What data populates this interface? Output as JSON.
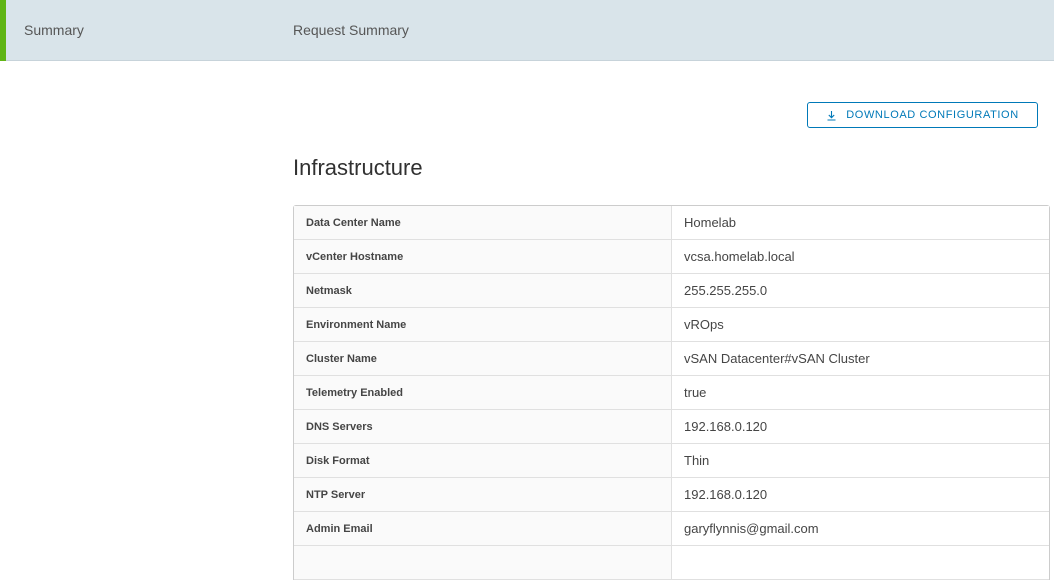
{
  "header": {
    "step_label": "Summary",
    "title": "Request Summary",
    "accent_color": "#60b515"
  },
  "actions": {
    "download_label": "DOWNLOAD CONFIGURATION",
    "download_icon": "download-icon"
  },
  "section": {
    "title": "Infrastructure"
  },
  "rows": [
    {
      "key": "Data Center Name",
      "value": "Homelab"
    },
    {
      "key": "vCenter Hostname",
      "value": "vcsa.homelab.local"
    },
    {
      "key": "Netmask",
      "value": "255.255.255.0"
    },
    {
      "key": "Environment Name",
      "value": "vROps"
    },
    {
      "key": "Cluster Name",
      "value": "vSAN Datacenter#vSAN Cluster"
    },
    {
      "key": "Telemetry Enabled",
      "value": "true"
    },
    {
      "key": "DNS Servers",
      "value": "192.168.0.120"
    },
    {
      "key": "Disk Format",
      "value": "Thin"
    },
    {
      "key": "NTP Server",
      "value": "192.168.0.120"
    },
    {
      "key": "Admin Email",
      "value": "garyflynnis@gmail.com"
    },
    {
      "key": "",
      "value": ""
    }
  ]
}
